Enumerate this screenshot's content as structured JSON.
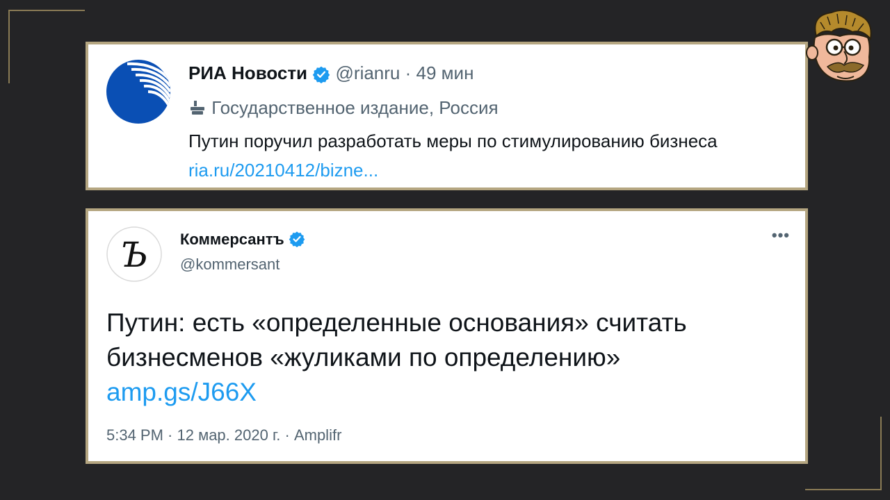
{
  "colors": {
    "background": "#242426",
    "card_border": "#b5a681",
    "link": "#1d9bf0",
    "secondary_text": "#536471",
    "verified": "#1d9bf0"
  },
  "tweet1": {
    "avatar_icon": "ria-novosti-logo",
    "name": "РИА Новости",
    "handle": "@rianru",
    "separator": "·",
    "time": "49 мин",
    "label_icon": "state-media-icon",
    "label": "Государственное издание, Россия",
    "text": "Путин поручил разработать меры по стимулированию бизнеса",
    "link": "ria.ru/20210412/bizne..."
  },
  "tweet2": {
    "avatar_icon": "kommersant-logo",
    "name": "Коммерсантъ",
    "handle": "@kommersant",
    "more_icon": "more-options-icon",
    "more_label": "•••",
    "text_line1": "Путин: есть «определенные основания» считать",
    "text_line2": "бизнесменов «жуликами по определению»",
    "link": "amp.gs/J66X",
    "meta": "5:34 PM · 12 мар. 2020 г. · Amplifr"
  },
  "mascot_icon": "cartoon-face-icon"
}
